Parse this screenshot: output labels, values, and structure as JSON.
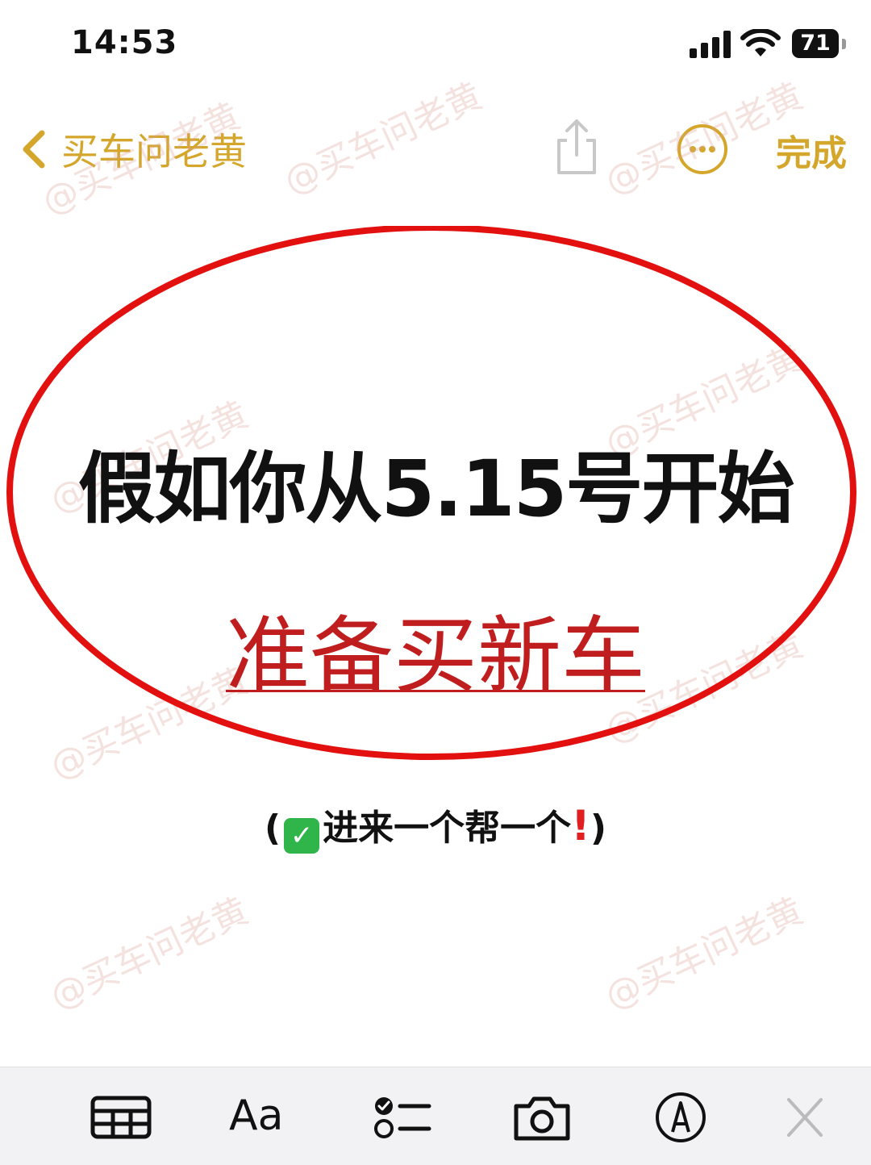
{
  "status_bar": {
    "time": "14:53",
    "battery": "71"
  },
  "nav": {
    "back_label": "买车问老黄",
    "done_label": "完成",
    "accent_color": "#d4a72c"
  },
  "watermark_text": "@买车问老黄",
  "content": {
    "headline": "假如你从5.15号开始",
    "subheadline": "准备买新车",
    "tagline_open": "(",
    "tagline_text": "进来一个帮一个",
    "tagline_close": ")",
    "ellipse_color": "#e31010",
    "subheadline_color": "#c01e1e"
  },
  "toolbar": {
    "format_label": "Aa"
  }
}
